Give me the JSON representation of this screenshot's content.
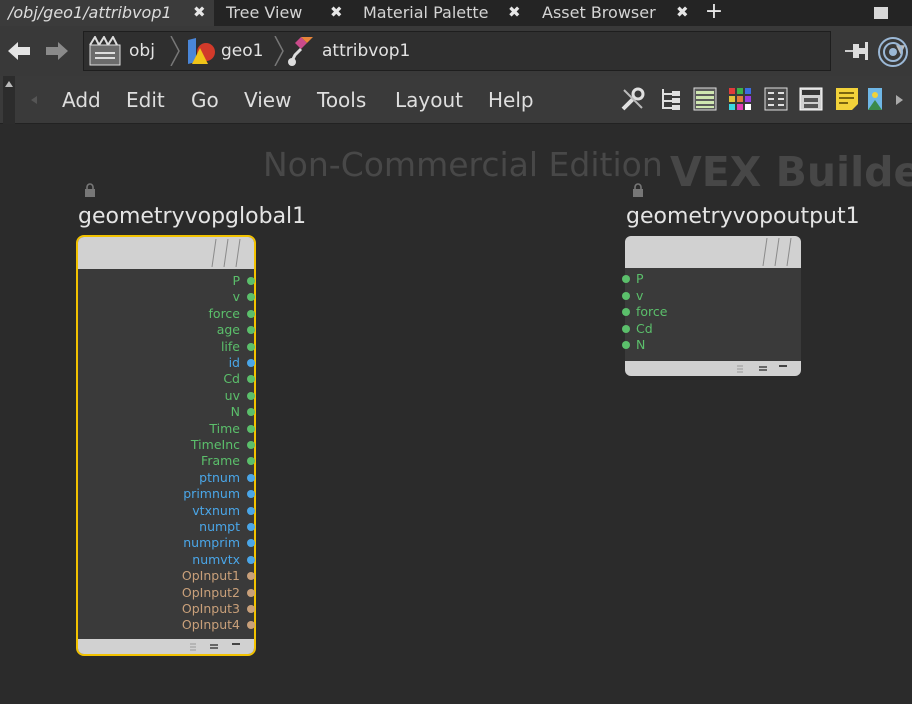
{
  "tabs": [
    {
      "label": "/obj/geo1/attribvop1",
      "active": true
    },
    {
      "label": "Tree View",
      "active": false
    },
    {
      "label": "Material Palette",
      "active": false
    },
    {
      "label": "Asset Browser",
      "active": false
    }
  ],
  "tab_close": "✖",
  "tab_add": "+",
  "breadcrumbs": [
    {
      "label": "obj",
      "icon": "obj-context-icon"
    },
    {
      "label": "geo1",
      "icon": "geometry-shapes-icon"
    },
    {
      "label": "attribvop1",
      "icon": "vop-network-icon"
    }
  ],
  "menu": [
    "Add",
    "Edit",
    "Go",
    "View",
    "Tools",
    "Layout",
    "Help"
  ],
  "toolbar_icons": [
    "wrench-icon",
    "tree-icon",
    "list-icon",
    "color-grid-icon",
    "parameters-icon",
    "layout-icon",
    "sticky-note-icon",
    "image-icon"
  ],
  "watermark": "Non-Commercial Edition",
  "network_type": "VEX Builder",
  "nodes": {
    "global": {
      "name": "geometryvopglobal1",
      "outputs": [
        {
          "label": "P",
          "color": "#5bbf6b"
        },
        {
          "label": "v",
          "color": "#5bbf6b"
        },
        {
          "label": "force",
          "color": "#5bbf6b"
        },
        {
          "label": "age",
          "color": "#5bbf6b"
        },
        {
          "label": "life",
          "color": "#5bbf6b"
        },
        {
          "label": "id",
          "color": "#4aa6e8"
        },
        {
          "label": "Cd",
          "color": "#5bbf6b"
        },
        {
          "label": "uv",
          "color": "#5bbf6b"
        },
        {
          "label": "N",
          "color": "#5bbf6b"
        },
        {
          "label": "Time",
          "color": "#5bbf6b"
        },
        {
          "label": "TimeInc",
          "color": "#5bbf6b"
        },
        {
          "label": "Frame",
          "color": "#5bbf6b"
        },
        {
          "label": "ptnum",
          "color": "#4aa6e8"
        },
        {
          "label": "primnum",
          "color": "#4aa6e8"
        },
        {
          "label": "vtxnum",
          "color": "#4aa6e8"
        },
        {
          "label": "numpt",
          "color": "#4aa6e8"
        },
        {
          "label": "numprim",
          "color": "#4aa6e8"
        },
        {
          "label": "numvtx",
          "color": "#4aa6e8"
        },
        {
          "label": "OpInput1",
          "color": "#c9a07a"
        },
        {
          "label": "OpInput2",
          "color": "#c9a07a"
        },
        {
          "label": "OpInput3",
          "color": "#c9a07a"
        },
        {
          "label": "OpInput4",
          "color": "#c9a07a"
        }
      ]
    },
    "output": {
      "name": "geometryvopoutput1",
      "inputs": [
        {
          "label": "P",
          "color": "#5bbf6b"
        },
        {
          "label": "v",
          "color": "#5bbf6b"
        },
        {
          "label": "force",
          "color": "#5bbf6b"
        },
        {
          "label": "Cd",
          "color": "#5bbf6b"
        },
        {
          "label": "N",
          "color": "#5bbf6b"
        }
      ]
    }
  },
  "colors": {
    "selected_border": "#f2c200",
    "int_port": "#4aa6e8",
    "float_port": "#5bbf6b",
    "string_port": "#c9a07a"
  }
}
